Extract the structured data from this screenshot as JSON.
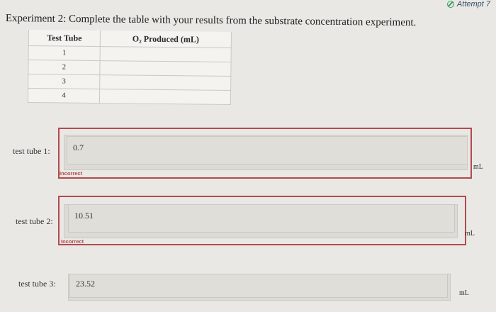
{
  "attempt_label": "Attempt 7",
  "instruction": "Experiment 2: Complete the table with your results from the substrate concentration experiment.",
  "table": {
    "headers": [
      "Test Tube",
      "O₂ Produced (mL)"
    ],
    "rows": [
      [
        "1",
        ""
      ],
      [
        "2",
        ""
      ],
      [
        "3",
        ""
      ],
      [
        "4",
        ""
      ]
    ]
  },
  "answers": [
    {
      "label": "test tube 1:",
      "value": "0.7",
      "status": "Incorrect",
      "unit": "mL"
    },
    {
      "label": "test tube 2:",
      "value": "10.51",
      "status": "Incorrect",
      "unit": "mL"
    },
    {
      "label": "test tube 3:",
      "value": "23.52",
      "status": "",
      "unit": "mL"
    }
  ]
}
